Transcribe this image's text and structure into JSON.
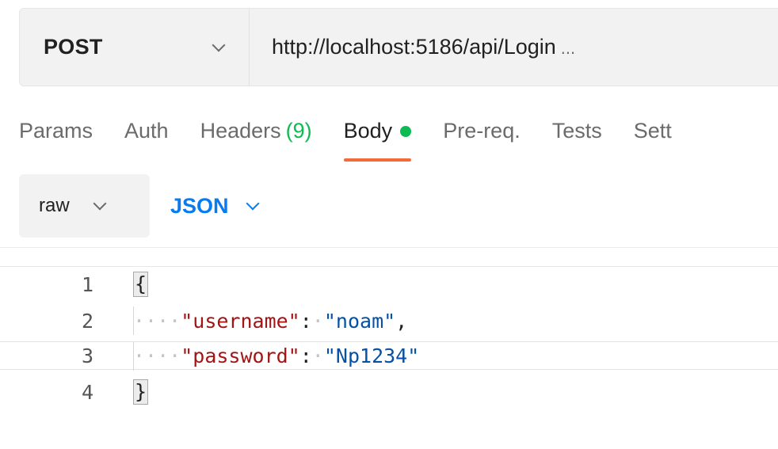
{
  "request": {
    "method": "POST",
    "url": "http://localhost:5186/api/Login",
    "url_overflow": "..."
  },
  "tabs": [
    {
      "label": "Params"
    },
    {
      "label": "Auth"
    },
    {
      "label": "Headers",
      "count": "(9)"
    },
    {
      "label": "Body"
    },
    {
      "label": "Pre-req."
    },
    {
      "label": "Tests"
    },
    {
      "label": "Sett"
    }
  ],
  "body_options": {
    "mode": "raw",
    "language": "JSON"
  },
  "editor": {
    "lines": [
      {
        "number": "1",
        "open_brace": "{"
      },
      {
        "number": "2",
        "ws": "····",
        "key": "\"username\"",
        "colon": ":",
        "sp": "·",
        "value": "\"noam\"",
        "trail": ","
      },
      {
        "number": "3",
        "ws": "····",
        "key": "\"password\"",
        "colon": ":",
        "sp": "·",
        "value": "\"Np1234\""
      },
      {
        "number": "4",
        "close_brace": "}"
      }
    ]
  },
  "colors": {
    "active_tab_underline": "#f26b3a",
    "status_green": "#0cbb52",
    "json_blue": "#097bed",
    "json_key": "#a31515",
    "json_string": "#0451a5"
  }
}
